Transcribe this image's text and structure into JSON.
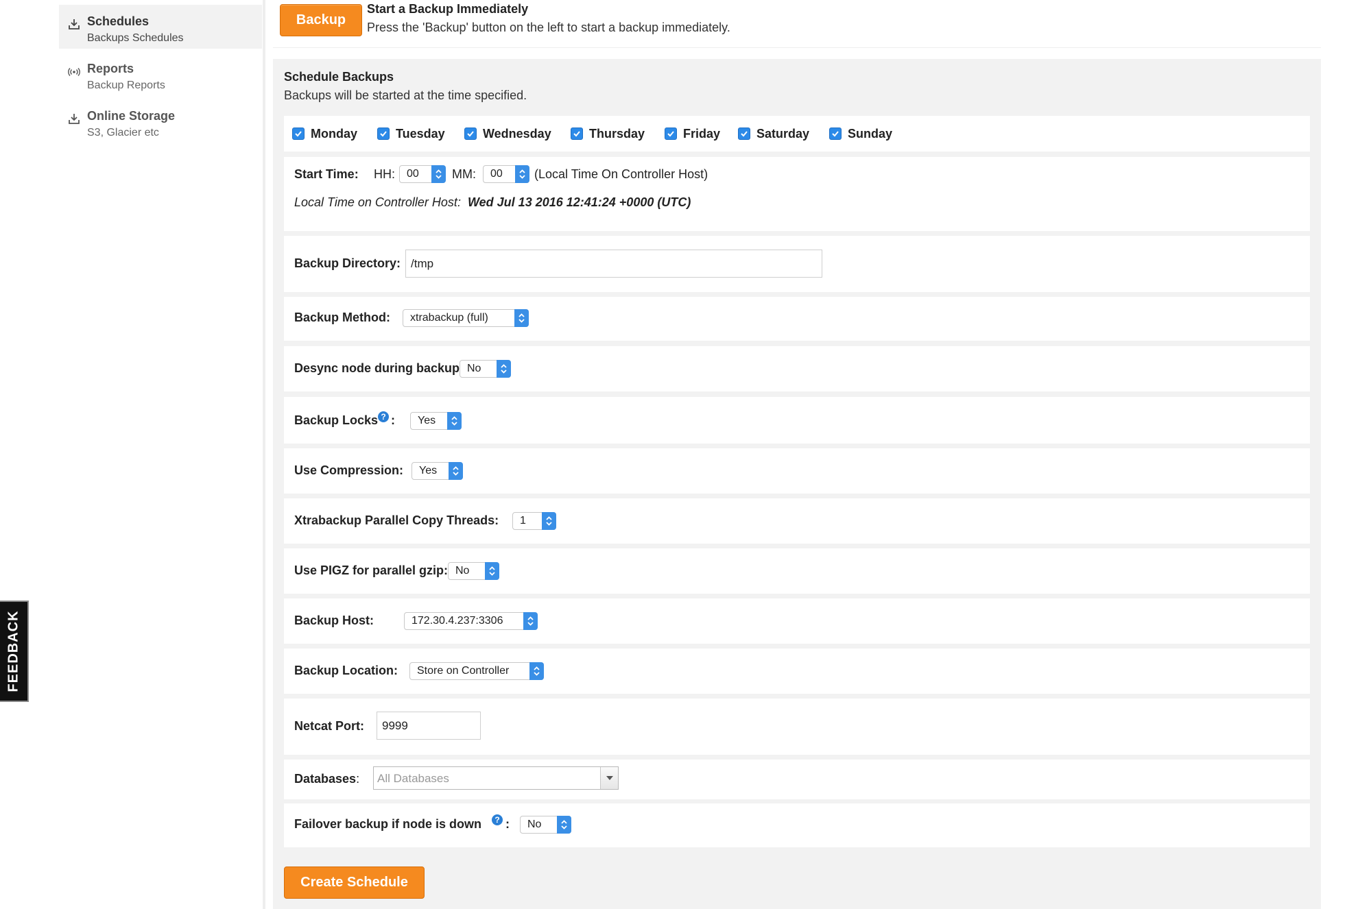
{
  "sidebar": {
    "items": [
      {
        "title": "Schedules",
        "subtitle": "Backups Schedules",
        "icon": "download-icon",
        "active": true
      },
      {
        "title": "Reports",
        "subtitle": "Backup Reports",
        "icon": "broadcast-icon",
        "active": false
      },
      {
        "title": "Online Storage",
        "subtitle": "S3, Glacier etc",
        "icon": "download-icon",
        "active": false
      }
    ]
  },
  "feedback": {
    "label": "FEEDBACK"
  },
  "topbar": {
    "button_label": "Backup",
    "title": "Start a Backup Immediately",
    "description": "Press the 'Backup' button on the left to start a backup immediately."
  },
  "schedule": {
    "title": "Schedule Backups",
    "description": "Backups will be started at the time specified.",
    "days": [
      {
        "label": "Monday",
        "checked": true
      },
      {
        "label": "Tuesday",
        "checked": true
      },
      {
        "label": "Wednesday",
        "checked": true
      },
      {
        "label": "Thursday",
        "checked": true
      },
      {
        "label": "Friday",
        "checked": true
      },
      {
        "label": "Saturday",
        "checked": true
      },
      {
        "label": "Sunday",
        "checked": true
      }
    ],
    "start_time": {
      "label": "Start Time:",
      "hh_label": "HH:",
      "hh_value": "00",
      "mm_label": "MM:",
      "mm_value": "00",
      "note": "(Local Time On Controller Host)",
      "local_time_label": "Local Time on Controller Host:",
      "local_time_value": "Wed Jul 13 2016 12:41:24 +0000 (UTC)"
    },
    "backup_directory": {
      "label": "Backup Directory:",
      "value": "/tmp"
    },
    "backup_method": {
      "label": "Backup Method:",
      "value": "xtrabackup (full)"
    },
    "desync": {
      "label": "Desync node during backup:",
      "value": "No"
    },
    "backup_locks": {
      "label": "Backup Locks",
      "colon": ":",
      "value": "Yes"
    },
    "compression": {
      "label": "Use Compression:",
      "value": "Yes"
    },
    "threads": {
      "label": "Xtrabackup Parallel Copy Threads:",
      "value": "1"
    },
    "pigz": {
      "label": "Use PIGZ for parallel gzip:",
      "value": "No"
    },
    "backup_host": {
      "label": "Backup Host:",
      "value": "172.30.4.237:3306"
    },
    "backup_location": {
      "label": "Backup Location:",
      "value": "Store on Controller"
    },
    "netcat_port": {
      "label": "Netcat Port:",
      "value": "9999"
    },
    "databases": {
      "label": "Databases",
      "colon": ":",
      "placeholder": "All Databases"
    },
    "failover": {
      "label": "Failover backup if node is down",
      "colon": ":",
      "value": "No"
    },
    "create_button": "Create Schedule"
  },
  "colors": {
    "accent_orange": "#f58a1f",
    "select_blue": "#3a8fe6",
    "checkbox_blue": "#2c8ae8",
    "panel_bg": "#f2f2f2"
  }
}
